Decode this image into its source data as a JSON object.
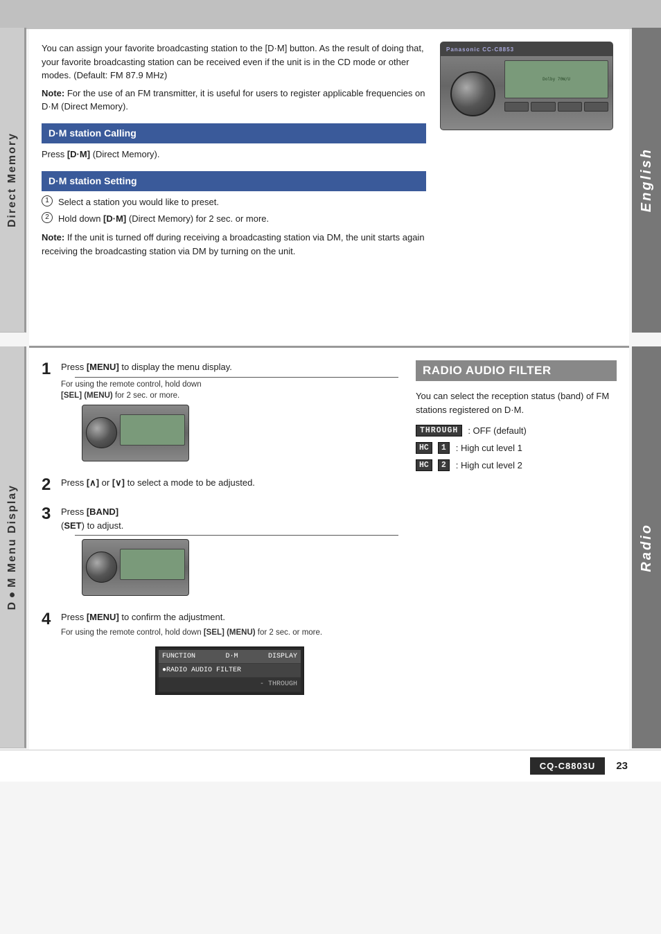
{
  "header": {
    "bg_color": "#c0c0c0"
  },
  "sidebar_left": {
    "top_label": "Direct Memory",
    "bottom_label": "D●M Menu Display"
  },
  "sidebar_right": {
    "top_label": "English",
    "bottom_label": "Radio"
  },
  "section_top": {
    "intro_text": "You can assign your favorite broadcasting station to the [D·M] button. As the result of doing that, your favorite broadcasting station can be received even if the unit is in the CD mode or other modes. (Default: FM 87.9 MHz)",
    "note1": "Note:",
    "note1_text": " For the use of an FM transmitter, it is useful for users to register applicable frequencies on D·M (Direct Memory).",
    "dm_station_calling_header": "D·M station Calling",
    "dm_calling_text": "Press [D·M] (Direct Memory).",
    "dm_station_setting_header": "D·M station Setting",
    "dm_setting_step1": "Select a station you would like to preset.",
    "dm_setting_step2": "Hold down [D·M] (Direct Memory) for 2 sec. or more.",
    "note2": "Note:",
    "note2_text": " If the unit is turned off during receiving a broadcasting station via DM, the unit starts again receiving the broadcasting station via DM by turning on the unit."
  },
  "section_bottom": {
    "step1_num": "1",
    "step1_text": "Press [MENU] to display the menu display.",
    "step1_note": "For using the remote control, hold down [SEL] (MENU) for 2 sec. or more.",
    "step2_num": "2",
    "step2_text": "Press [∧] or [∨] to select a mode to be adjusted.",
    "step3_num": "3",
    "step3_text": "Press [BAND] (SET) to adjust.",
    "step4_num": "4",
    "step4_text": "Press [MENU] to confirm the adjustment.",
    "step4_note": "For using the remote control, hold down [SEL] (MENU) for 2 sec. or more.",
    "radio_filter_header": "RADIO AUDIO FILTER",
    "radio_filter_desc": "You can select the reception status (band) of FM stations registered on D·M.",
    "through_label": "THROUGH",
    "through_desc": ": OFF (default)",
    "hc1_label": "HC",
    "hc1_num": "1",
    "hc1_desc": ": High cut level 1",
    "hc2_label": "HC",
    "hc2_num": "2",
    "hc2_desc": ": High cut level 2",
    "lcd_row1_col1": "FUNCTION",
    "lcd_row1_col2": "D·M",
    "lcd_row1_col3": "DISPLAY",
    "lcd_row2": "●RADIO AUDIO FILTER",
    "lcd_row3_right": "- THROUGH"
  },
  "footer": {
    "model": "CQ-C8803U",
    "page": "23"
  }
}
